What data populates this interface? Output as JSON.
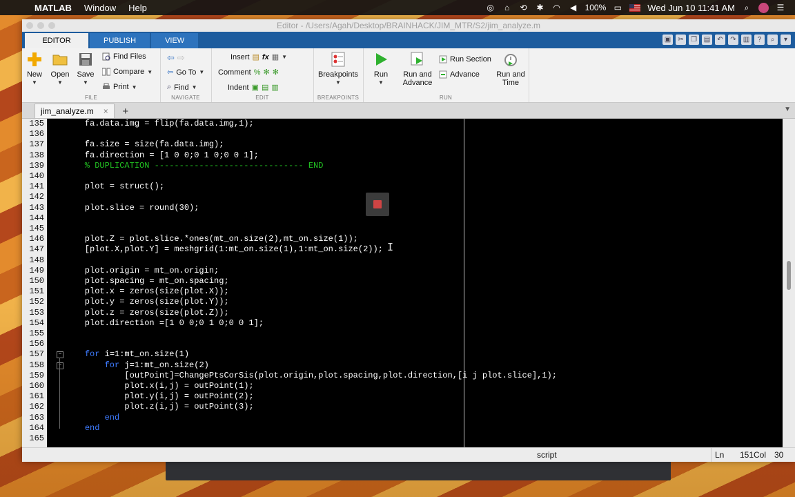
{
  "menubar": {
    "app": "MATLAB",
    "items": [
      "Window",
      "Help"
    ],
    "battery": "100%",
    "datetime": "Wed Jun 10  11:41 AM"
  },
  "window": {
    "title": "Editor - /Users/Agah/Desktop/BRAINHACK/JIM_MTR/S2/jim_analyze.m"
  },
  "toolstrip": {
    "tabs": [
      "EDITOR",
      "PUBLISH",
      "VIEW"
    ]
  },
  "ribbon": {
    "file": {
      "label": "FILE",
      "new": "New",
      "open": "Open",
      "save": "Save",
      "find_files": "Find Files",
      "compare": "Compare",
      "print": "Print"
    },
    "navigate": {
      "label": "NAVIGATE",
      "go_to": "Go To",
      "find": "Find"
    },
    "edit": {
      "label": "EDIT",
      "insert": "Insert",
      "fx": "fx",
      "comment": "Comment",
      "comment_sym": "%",
      "indent": "Indent"
    },
    "breakpoints": {
      "label": "BREAKPOINTS",
      "breakpoints": "Breakpoints"
    },
    "run": {
      "label": "RUN",
      "run": "Run",
      "run_and_advance_1": "Run and",
      "run_and_advance_2": "Advance",
      "run_section": "Run Section",
      "advance": "Advance",
      "run_and_time_1": "Run and",
      "run_and_time_2": "Time"
    }
  },
  "doc_tab": {
    "name": "jim_analyze.m",
    "close": "×",
    "add": "+"
  },
  "editor": {
    "line_numbers": [
      "135",
      "136",
      "137",
      "138",
      "139",
      "140",
      "141",
      "142",
      "143",
      "144",
      "145",
      "146",
      "147",
      "148",
      "149",
      "150",
      "151",
      "152",
      "153",
      "154",
      "155",
      "156",
      "157",
      "158",
      "159",
      "160",
      "161",
      "162",
      "163",
      "164",
      "165"
    ],
    "lines": [
      {
        "text": "    fa.data.img = flip(fa.data.img,1);"
      },
      {
        "text": ""
      },
      {
        "text": "    fa.size = size(fa.data.img);"
      },
      {
        "text": "    fa.direction = [1 0 0;0 1 0;0 0 1];"
      },
      {
        "text": "    % DUPLICATION ------------------------------ END",
        "cls": "comment"
      },
      {
        "text": ""
      },
      {
        "text": "    plot = struct();"
      },
      {
        "text": ""
      },
      {
        "text": "    plot.slice = round(30);"
      },
      {
        "text": ""
      },
      {
        "text": ""
      },
      {
        "text": "    plot.Z = plot.slice.*ones(mt_on.size(2),mt_on.size(1));"
      },
      {
        "text": "    [plot.X,plot.Y] = meshgrid(1:mt_on.size(1),1:mt_on.size(2));"
      },
      {
        "text": ""
      },
      {
        "text": "    plot.origin = mt_on.origin;"
      },
      {
        "text": "    plot.spacing = mt_on.spacing;"
      },
      {
        "text": "    plot.x = zeros(size(plot.X));"
      },
      {
        "text": "    plot.y = zeros(size(plot.Y));"
      },
      {
        "text": "    plot.z = zeros(size(plot.Z));"
      },
      {
        "text": "    plot.direction =[1 0 0;0 1 0;0 0 1];"
      },
      {
        "text": ""
      },
      {
        "text": ""
      },
      {
        "kw": "for",
        "text": " i=1:mt_on.size(1)",
        "indent": "    "
      },
      {
        "kw": "for",
        "text": " j=1:mt_on.size(2)",
        "indent": "        "
      },
      {
        "text": "            [outPoint]=ChangePtsCorSis(plot.origin,plot.spacing,plot.direction,[i j plot.slice],1);"
      },
      {
        "text": "            plot.x(i,j) = outPoint(1);"
      },
      {
        "text": "            plot.y(i,j) = outPoint(2);"
      },
      {
        "text": "            plot.z(i,j) = outPoint(3);"
      },
      {
        "kw": "end",
        "text": "",
        "indent": "        "
      },
      {
        "kw": "end",
        "text": "",
        "indent": "    "
      },
      {
        "text": ""
      }
    ]
  },
  "statusbar": {
    "mode": "script",
    "ln_label": "Ln",
    "ln_value": "151",
    "col_label": "Col",
    "col_value": "30"
  }
}
